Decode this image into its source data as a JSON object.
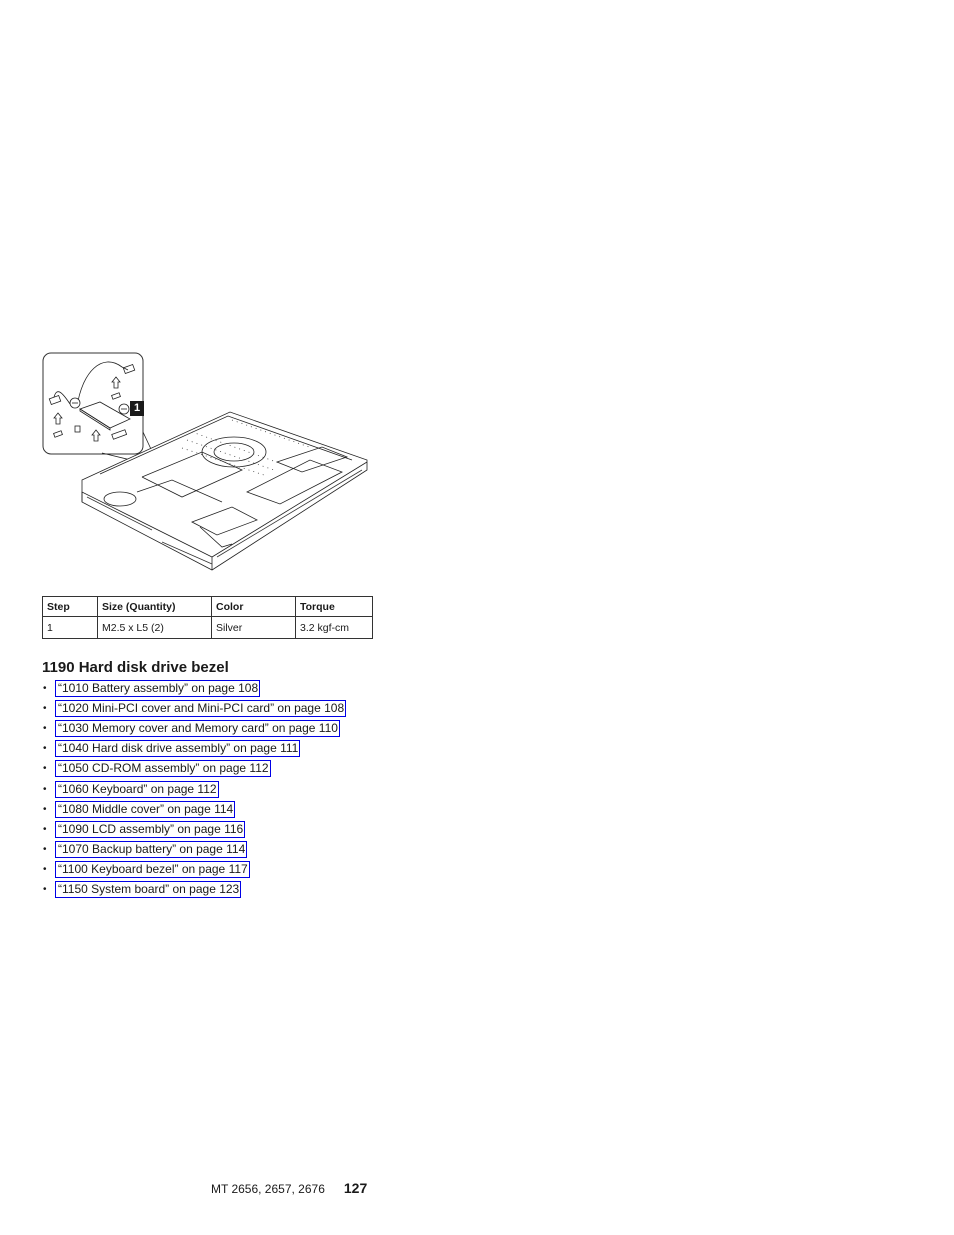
{
  "figure": {
    "callout_label": "1",
    "description": "Exploded view: Mini-PCI card removal with screw callout 1 on notebook base"
  },
  "torque_table": {
    "headers": [
      "Step",
      "Size (Quantity)",
      "Color",
      "Torque"
    ],
    "rows": [
      [
        "1",
        "M2.5 x L5 (2)",
        "Silver",
        "3.2 kgf-cm"
      ]
    ]
  },
  "section": {
    "title": "1190 Hard disk drive bezel",
    "bullet_glyph": "•",
    "links": [
      "“1010 Battery assembly” on page 108",
      "“1020 Mini-PCI cover and Mini-PCI card” on page 108",
      "“1030 Memory cover and Memory card” on page 110",
      "“1040 Hard disk drive assembly” on page 111",
      "“1050 CD-ROM assembly” on page 112",
      "“1060 Keyboard” on page 112",
      "“1080 Middle cover” on page 114",
      "“1090 LCD assembly” on page 116",
      "“1070 Backup battery” on page 114",
      "“1100 Keyboard bezel” on page 117",
      "“1150 System board” on page 123"
    ]
  },
  "footer": {
    "machine_types": "MT 2656, 2657, 2676",
    "page_number": "127"
  },
  "colors": {
    "link_border": "#0000e6",
    "text": "#1a1a1a"
  }
}
